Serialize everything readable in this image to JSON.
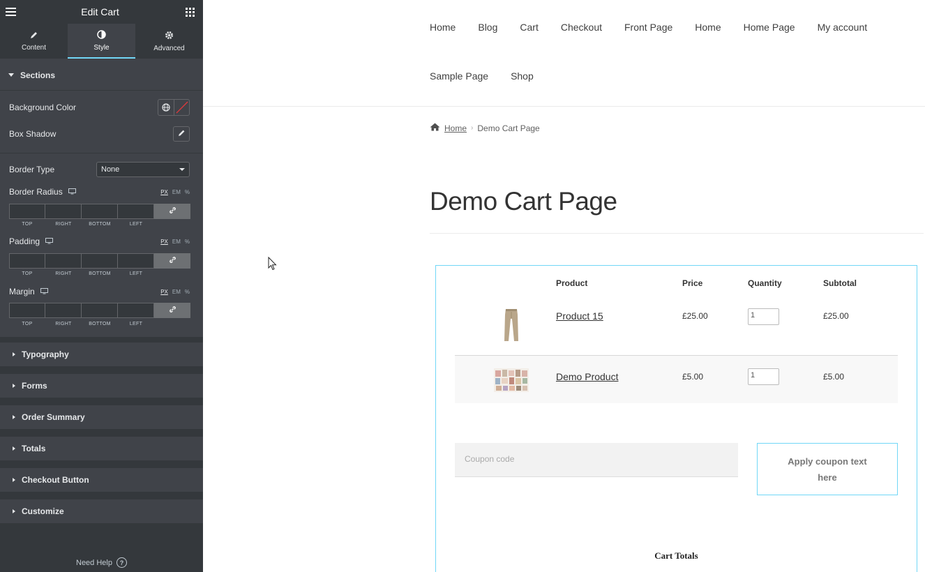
{
  "editor": {
    "title": "Edit Cart",
    "tabs": [
      {
        "label": "Content",
        "icon": "pencil-icon"
      },
      {
        "label": "Style",
        "icon": "contrast-icon",
        "active": true
      },
      {
        "label": "Advanced",
        "icon": "gear-icon"
      }
    ],
    "sections_title": "Sections",
    "background_color_label": "Background Color",
    "box_shadow_label": "Box Shadow",
    "border_type_label": "Border Type",
    "border_type_value": "None",
    "border_radius_label": "Border Radius",
    "padding_label": "Padding",
    "margin_label": "Margin",
    "units": {
      "px": "PX",
      "em": "EM",
      "pct": "%"
    },
    "dim_caps": {
      "top": "TOP",
      "right": "RIGHT",
      "bottom": "BOTTOM",
      "left": "LEFT"
    },
    "collapsed_sections": [
      "Typography",
      "Forms",
      "Order Summary",
      "Totals",
      "Checkout Button",
      "Customize"
    ],
    "need_help": "Need Help",
    "accent_color": "#71d7f7"
  },
  "site": {
    "nav": [
      "Home",
      "Blog",
      "Cart",
      "Checkout",
      "Front Page",
      "Home",
      "Home Page",
      "My account",
      "Sample Page",
      "Shop"
    ],
    "breadcrumb": {
      "home": "Home",
      "current": "Demo Cart Page"
    },
    "page_title": "Demo Cart Page"
  },
  "cart": {
    "headers": {
      "product": "Product",
      "price": "Price",
      "quantity": "Quantity",
      "subtotal": "Subtotal"
    },
    "items": [
      {
        "name": "Product 15",
        "price": "£25.00",
        "qty": "1",
        "subtotal": "£25.00"
      },
      {
        "name": "Demo Product",
        "price": "£5.00",
        "qty": "1",
        "subtotal": "£5.00"
      }
    ],
    "coupon_placeholder": "Coupon code",
    "apply_button": "Apply coupon text here",
    "totals_title": "Cart Totals"
  }
}
